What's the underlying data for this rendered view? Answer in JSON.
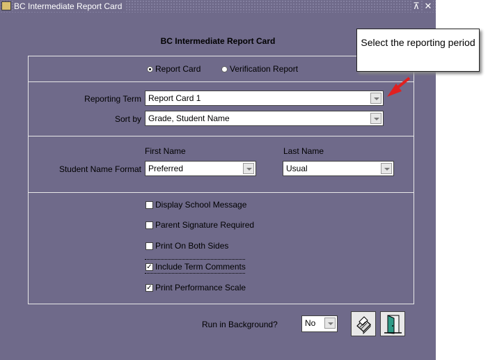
{
  "window": {
    "title": "BC Intermediate Report Card"
  },
  "form": {
    "title": "BC Intermediate Report Card",
    "report_type": {
      "options": [
        {
          "label": "Report Card",
          "selected": true
        },
        {
          "label": "Verification Report",
          "selected": false
        }
      ]
    },
    "reporting_term": {
      "label": "Reporting Term",
      "value": "Report Card 1"
    },
    "sort_by": {
      "label": "Sort by",
      "value": "Grade,  Student Name"
    },
    "name_format": {
      "label": "Student Name Format",
      "first_name": {
        "label": "First Name",
        "value": "Preferred"
      },
      "last_name": {
        "label": "Last Name",
        "value": "Usual"
      }
    },
    "options": [
      {
        "label": "Display School Message",
        "checked": false
      },
      {
        "label": "Parent Signature Required",
        "checked": false
      },
      {
        "label": "Print On Both Sides",
        "checked": false
      },
      {
        "label": "Include Term Comments",
        "checked": true
      },
      {
        "label": "Print Performance Scale",
        "checked": true
      }
    ],
    "run_in_background": {
      "label": "Run in Background?",
      "value": "No"
    }
  },
  "callout": {
    "text": "Select the reporting period"
  },
  "colors": {
    "window_bg": "#6f6a8a",
    "arrow": "#e02020"
  },
  "icons": {
    "window": "app-icon",
    "print": "print-icon",
    "exit": "exit-door-icon"
  }
}
